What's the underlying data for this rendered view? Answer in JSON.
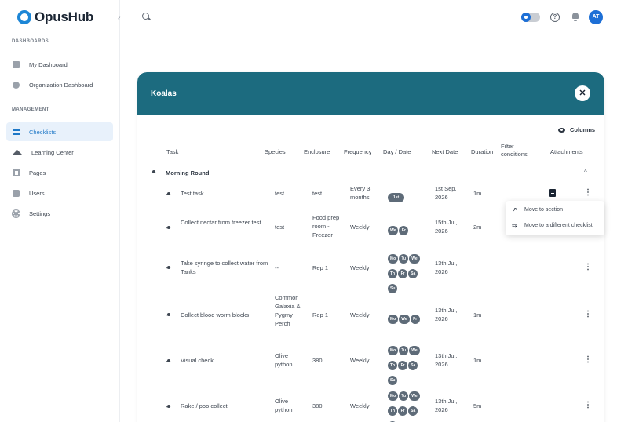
{
  "app": {
    "brand": "OpusHub"
  },
  "sidebar": {
    "sections": [
      {
        "label": "DASHBOARDS"
      },
      {
        "label": "MANAGEMENT"
      }
    ],
    "items": [
      {
        "label": "My Dashboard",
        "icon": "dashboard-icon"
      },
      {
        "label": "Organization Dashboard",
        "icon": "globe-icon"
      },
      {
        "label": "Checklists",
        "icon": "checklist-icon",
        "active": true
      },
      {
        "label": "Learning Center",
        "icon": "graduation-cap-icon"
      },
      {
        "label": "Pages",
        "icon": "page-icon"
      },
      {
        "label": "Users",
        "icon": "user-icon"
      },
      {
        "label": "Settings",
        "icon": "gear-icon"
      }
    ]
  },
  "topbar": {
    "help_glyph": "?",
    "avatar_initials": "AT"
  },
  "panel": {
    "title": "Koalas",
    "close_glyph": "✕",
    "columns_label": "Columns",
    "headers": [
      "Task",
      "Species",
      "Enclosure",
      "Frequency",
      "Day / Date",
      "Next Date",
      "Duration",
      "Filter conditions",
      "Attachments"
    ],
    "section": {
      "label": "Morning Round",
      "chevron": "^"
    },
    "rows": [
      {
        "task": "Test task",
        "species": "test",
        "enclosure": "test",
        "frequency": "Every 3 months",
        "days": [
          "1st"
        ],
        "next_date": "1st Sep, 2026",
        "duration": "1m",
        "has_attachment": true
      },
      {
        "task": "Collect nectar from freezer test",
        "species": "test",
        "enclosure": "Food prep room - Freezer",
        "frequency": "Weekly",
        "days": [
          "We",
          "Fr"
        ],
        "next_date": "15th Jul, 2026",
        "duration": "2m",
        "has_attachment": false
      },
      {
        "task": "Take syringe to collect water from Tanks",
        "species": "--",
        "enclosure": "Rep 1",
        "frequency": "Weekly",
        "days": [
          "Mo",
          "Tu",
          "We",
          "Th",
          "Fr",
          "Sa",
          "Su"
        ],
        "next_date": "13th Jul, 2026",
        "duration": "",
        "has_attachment": false
      },
      {
        "task": "Collect blood worm blocks",
        "species": "Common Galaxia & Pygmy Perch",
        "enclosure": "Rep 1",
        "frequency": "Weekly",
        "days": [
          "Mo",
          "We",
          "Fr"
        ],
        "next_date": "13th Jul, 2026",
        "duration": "1m",
        "has_attachment": false
      },
      {
        "task": "Visual check",
        "species": "Olive python",
        "enclosure": "380",
        "frequency": "Weekly",
        "days": [
          "Mo",
          "Tu",
          "We",
          "Th",
          "Fr",
          "Sa",
          "Su"
        ],
        "next_date": "13th Jul, 2026",
        "duration": "1m",
        "has_attachment": false
      },
      {
        "task": "Rake / poo collect",
        "species": "Olive python",
        "enclosure": "380",
        "frequency": "Weekly",
        "days": [
          "Mo",
          "Tu",
          "We",
          "Th",
          "Fr",
          "Sa",
          "Su"
        ],
        "next_date": "13th Jul, 2026",
        "duration": "5m",
        "has_attachment": false
      }
    ],
    "more_glyph": "⋮"
  },
  "context_menu": {
    "items": [
      {
        "label": "Move to section",
        "icon": "arrow-up-right-icon",
        "glyph": "↗"
      },
      {
        "label": "Move to a different checklist",
        "icon": "swap-icon",
        "glyph": "⇆"
      }
    ]
  },
  "colors": {
    "accent": "#1d6fd6",
    "panel_header": "#1c6b7f",
    "pill": "#5e6b78"
  }
}
